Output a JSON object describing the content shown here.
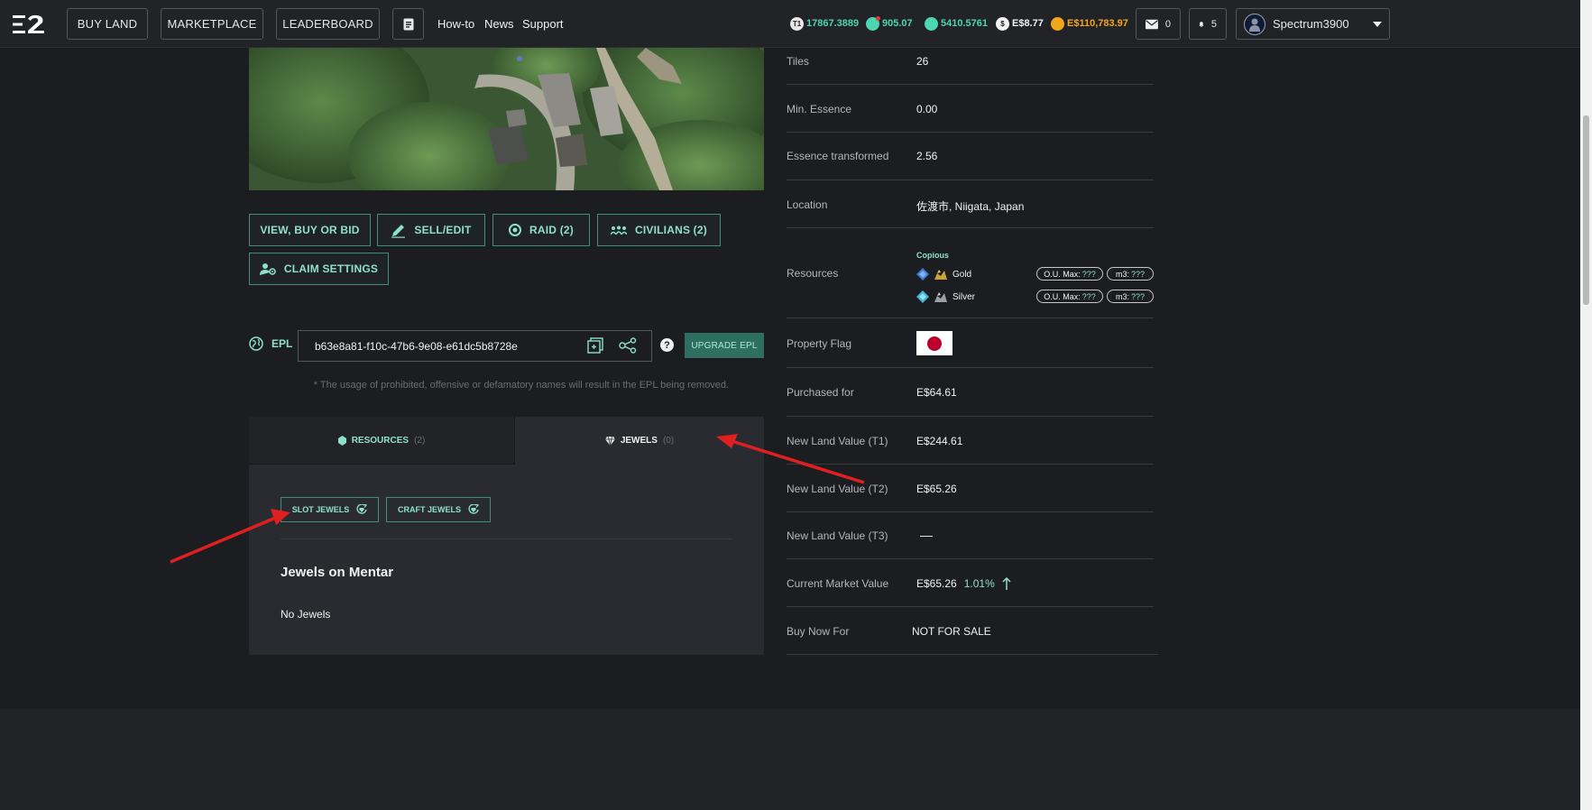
{
  "header": {
    "nav": {
      "buy_land": "BUY LAND",
      "marketplace": "MARKETPLACE",
      "leaderboard": "LEADERBOARD"
    },
    "links": {
      "howto": "How-to",
      "news": "News",
      "support": "Support"
    },
    "balances": {
      "t1_badge": "T1",
      "t1": "17867.3889",
      "gem": "905.07",
      "essence": "5410.5761",
      "dollar": "E$8.77",
      "gold": "E$110,783.97"
    },
    "colors": {
      "teal": "#4cd6b2",
      "gold": "#f2a71b",
      "accent_border": "#3f8f80"
    },
    "messages_count": "0",
    "notifications_count": "5",
    "username": "Spectrum3900"
  },
  "actions": {
    "view_buy_bid": "VIEW, BUY OR BID",
    "sell_edit": "SELL/EDIT",
    "raid": "RAID (2)",
    "civilians": "CIVILIANS (2)",
    "claim_settings": "CLAIM SETTINGS"
  },
  "epl": {
    "label": "EPL",
    "value": "b63e8a81-f10c-47b6-9e08-e61dc5b8728e",
    "help": "?",
    "upgrade": "UPGRADE EPL",
    "note": "* The usage of prohibited, offensive or defamatory names will result in the EPL being removed."
  },
  "tabs": {
    "resources_label": "RESOURCES",
    "resources_count": "(2)",
    "jewels_label": "JEWELS",
    "jewels_count": "(0)"
  },
  "jewels": {
    "slot": "SLOT JEWELS",
    "craft": "CRAFT JEWELS",
    "title": "Jewels on Mentar",
    "empty": "No Jewels"
  },
  "details": {
    "tiles_label": "Tiles",
    "tiles": "26",
    "min_essence_label": "Min. Essence",
    "min_essence": "0.00",
    "essence_transformed_label": "Essence transformed",
    "essence_transformed": "2.56",
    "location_label": "Location",
    "location": "佐渡市, Niigata, Japan",
    "resources_label": "Resources",
    "resources_tier": "Copious",
    "resources": [
      {
        "name": "Gold",
        "omax_label": "O.U. Max:",
        "omax": "???",
        "m3_label": "m3:",
        "m3": "???"
      },
      {
        "name": "Silver",
        "omax_label": "O.U. Max:",
        "omax": "???",
        "m3_label": "m3:",
        "m3": "???"
      }
    ],
    "flag_label": "Property Flag",
    "purchased_label": "Purchased for",
    "purchased": "E$64.61",
    "t1_label": "New Land Value (T1)",
    "t1": "E$244.61",
    "t2_label": "New Land Value (T2)",
    "t2": "E$65.26",
    "t3_label": "New Land Value (T3)",
    "t3": "—",
    "market_label": "Current Market Value",
    "market": "E$65.26",
    "market_change": "1.01%",
    "buy_now_label": "Buy Now For",
    "buy_now": "NOT FOR SALE"
  }
}
